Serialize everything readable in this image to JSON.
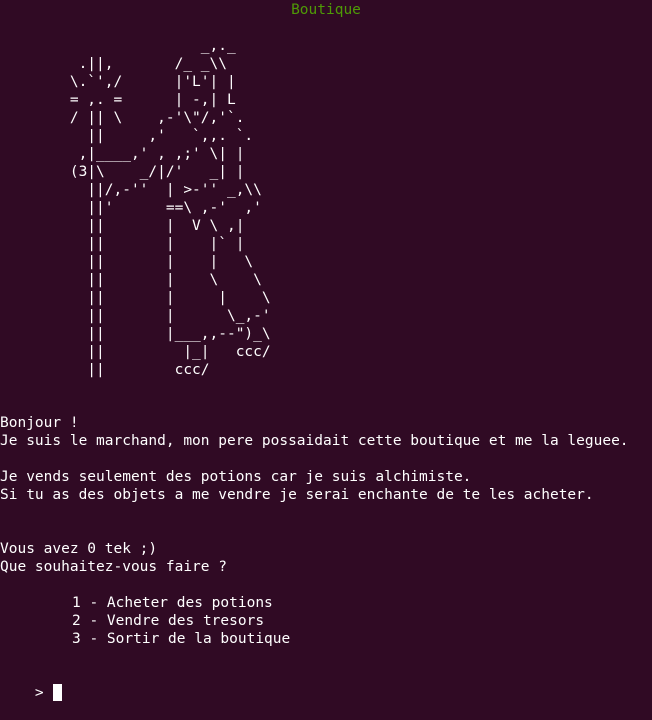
{
  "window": {
    "title": "Boutique"
  },
  "ascii_art": "                       _,._\n         .||,       /_ _\\\\\n        \\.`',/      |'L'| |\n        = ,. =      | -,| L\n        / || \\    ,-'\\\"/,'`.\n          ||     ,'   `,,. `.\n         ,|____,' , ,;' \\| |\n        (3|\\    _/|/'   _| |\n          ||/,-''  | >-'' _,\\\\\n          ||'      ==\\ ,-'  ,'\n          ||       |  V \\ ,|\n          ||       |    |` |\n          ||       |    |   \\\n          ||       |    \\    \\\n          ||       |     |    \\\n          ||       |      \\_,-'\n          ||       |___,,--\")_\\\n          ||         |_|   ccc/\n          ||        ccc/",
  "dialog": {
    "greeting": "Bonjour !",
    "intro": "Je suis le marchand, mon pere possaidait cette boutique et me la leguee.",
    "sells": "Je vends seulement des potions car je suis alchimiste.",
    "buys": "Si tu as des objets a me vendre je serai enchante de te les acheter.",
    "balance": "Vous avez 0 tek ;)",
    "question": "Que souhaitez-vous faire ?"
  },
  "menu": {
    "options": [
      {
        "label": "1 - Acheter des potions"
      },
      {
        "label": "2 - Vendre des tresors"
      },
      {
        "label": "3 - Sortir de la boutique"
      }
    ]
  },
  "prompt": {
    "symbol": ">"
  },
  "colors": {
    "background": "#300a24",
    "title": "#4e9a06",
    "text": "#ffffff"
  }
}
